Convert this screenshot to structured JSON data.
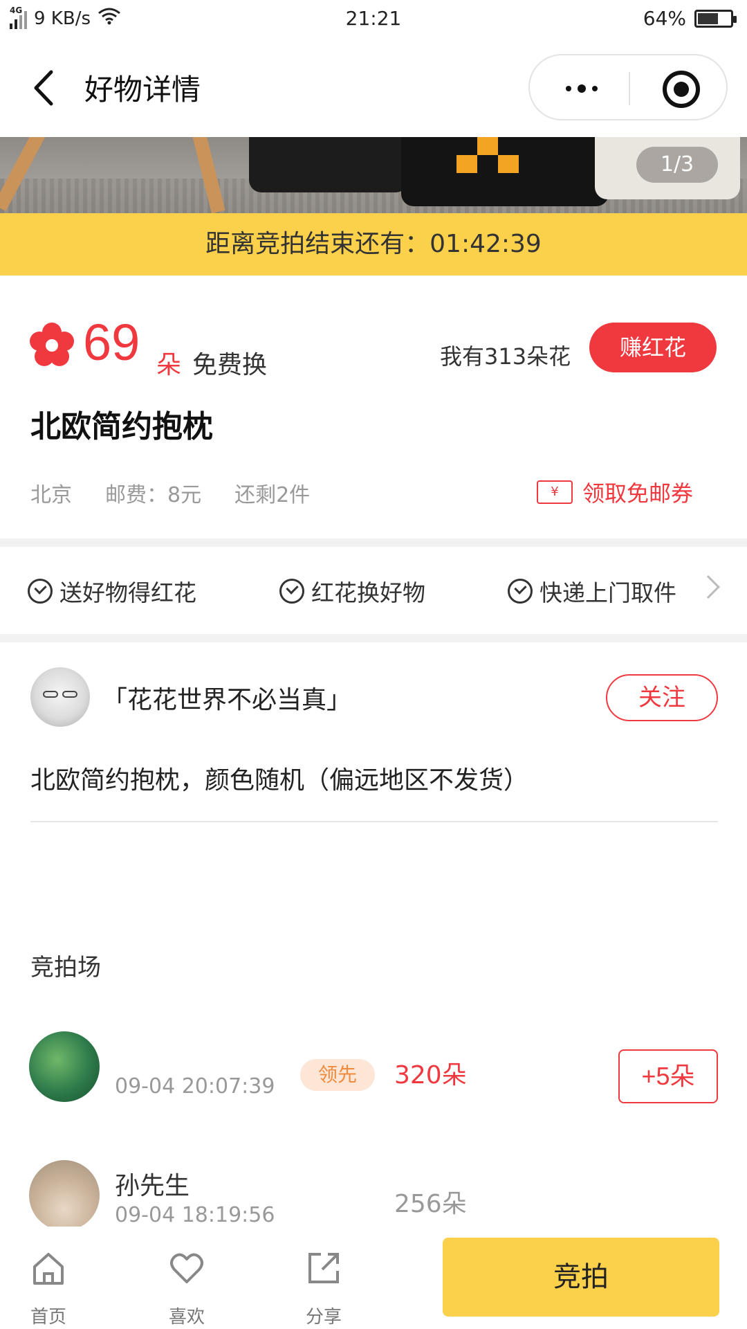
{
  "status_bar": {
    "network": "4G",
    "speed": "9 KB/s",
    "time": "21:21",
    "battery": "64%",
    "battery_level": 0.64
  },
  "nav": {
    "title": "好物详情"
  },
  "gallery": {
    "counter": "1/3"
  },
  "countdown": {
    "text": "距离竞拍结束还有：01:42:39"
  },
  "price": {
    "value": "69",
    "unit": "朵",
    "free_label": "免费换",
    "my_flowers": "我有313朵花",
    "earn_button": "赚红花"
  },
  "product": {
    "title": "北欧简约抱枕",
    "location": "北京",
    "shipping": "邮费：8元",
    "stock": "还剩2件",
    "coupon": "领取免邮券",
    "coupon_icon_text": "¥"
  },
  "features": [
    {
      "label": "送好物得红花"
    },
    {
      "label": "红花换好物"
    },
    {
      "label": "快递上门取件"
    }
  ],
  "seller": {
    "name": "「花花世界不必当真」",
    "follow_button": "关注",
    "description": "北欧简约抱枕，颜色随机（偏远地区不发货）"
  },
  "auction": {
    "heading": "竞拍场",
    "bids": [
      {
        "name": "",
        "time": "09-04 20:07:39",
        "badge": "领先",
        "amount": "320朵",
        "action": "+5朵"
      },
      {
        "name": "孙先生",
        "time": "09-04 18:19:56",
        "amount": "256朵"
      }
    ]
  },
  "bottom_bar": {
    "tabs": [
      {
        "label": "首页",
        "icon": "home-icon"
      },
      {
        "label": "喜欢",
        "icon": "heart-icon"
      },
      {
        "label": "分享",
        "icon": "share-icon"
      }
    ],
    "bid_button": "竞拍"
  },
  "colors": {
    "accent_red": "#f0383f",
    "accent_yellow": "#fbd14b",
    "lead_badge_bg": "#fde6d6"
  }
}
